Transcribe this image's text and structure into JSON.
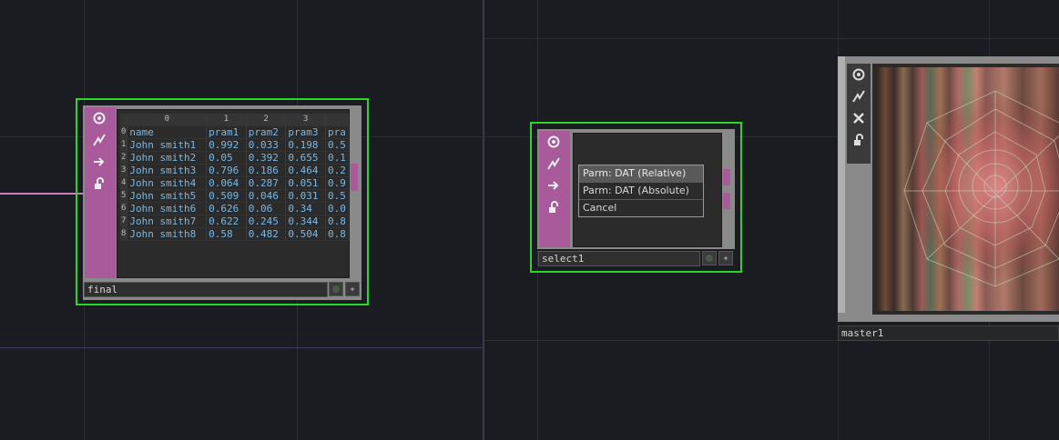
{
  "network": {
    "final_node": {
      "name": "final",
      "table": {
        "col_index": [
          "0",
          "1",
          "2",
          "3",
          ""
        ],
        "rows": [
          {
            "i": "0",
            "c": [
              "name",
              "pram1",
              "pram2",
              "pram3",
              "pra"
            ]
          },
          {
            "i": "1",
            "c": [
              "John smith1",
              "0.992",
              "0.033",
              "0.198",
              "0.5"
            ]
          },
          {
            "i": "2",
            "c": [
              "John smith2",
              "0.05",
              "0.392",
              "0.655",
              "0.1"
            ]
          },
          {
            "i": "3",
            "c": [
              "John smith3",
              "0.796",
              "0.186",
              "0.464",
              "0.2"
            ]
          },
          {
            "i": "4",
            "c": [
              "John smith4",
              "0.064",
              "0.287",
              "0.051",
              "0.9"
            ]
          },
          {
            "i": "5",
            "c": [
              "John smith5",
              "0.509",
              "0.046",
              "0.031",
              "0.5"
            ]
          },
          {
            "i": "6",
            "c": [
              "John smith6",
              "0.626",
              "0.06",
              "0.34",
              "0.0"
            ]
          },
          {
            "i": "7",
            "c": [
              "John smith7",
              "0.622",
              "0.245",
              "0.344",
              "0.8"
            ]
          },
          {
            "i": "8",
            "c": [
              "John smith8",
              "0.58",
              "0.482",
              "0.504",
              "0.8"
            ]
          }
        ]
      }
    },
    "select_node": {
      "name": "select1",
      "menu": [
        "Parm: DAT (Relative)",
        "Parm: DAT (Absolute)",
        "Cancel"
      ]
    },
    "master_node": {
      "name": "master1"
    }
  },
  "colors": {
    "background": "#1b1c21",
    "selection_border": "#27d927",
    "dat_family": "#a85a9b",
    "cell_text": "#7ab8e6"
  },
  "icons": [
    "viewer-toggle-icon",
    "bypass-icon",
    "export-arrow-icon",
    "lock-icon",
    "close-icon",
    "display-flag-icon",
    "render-flag-icon"
  ]
}
